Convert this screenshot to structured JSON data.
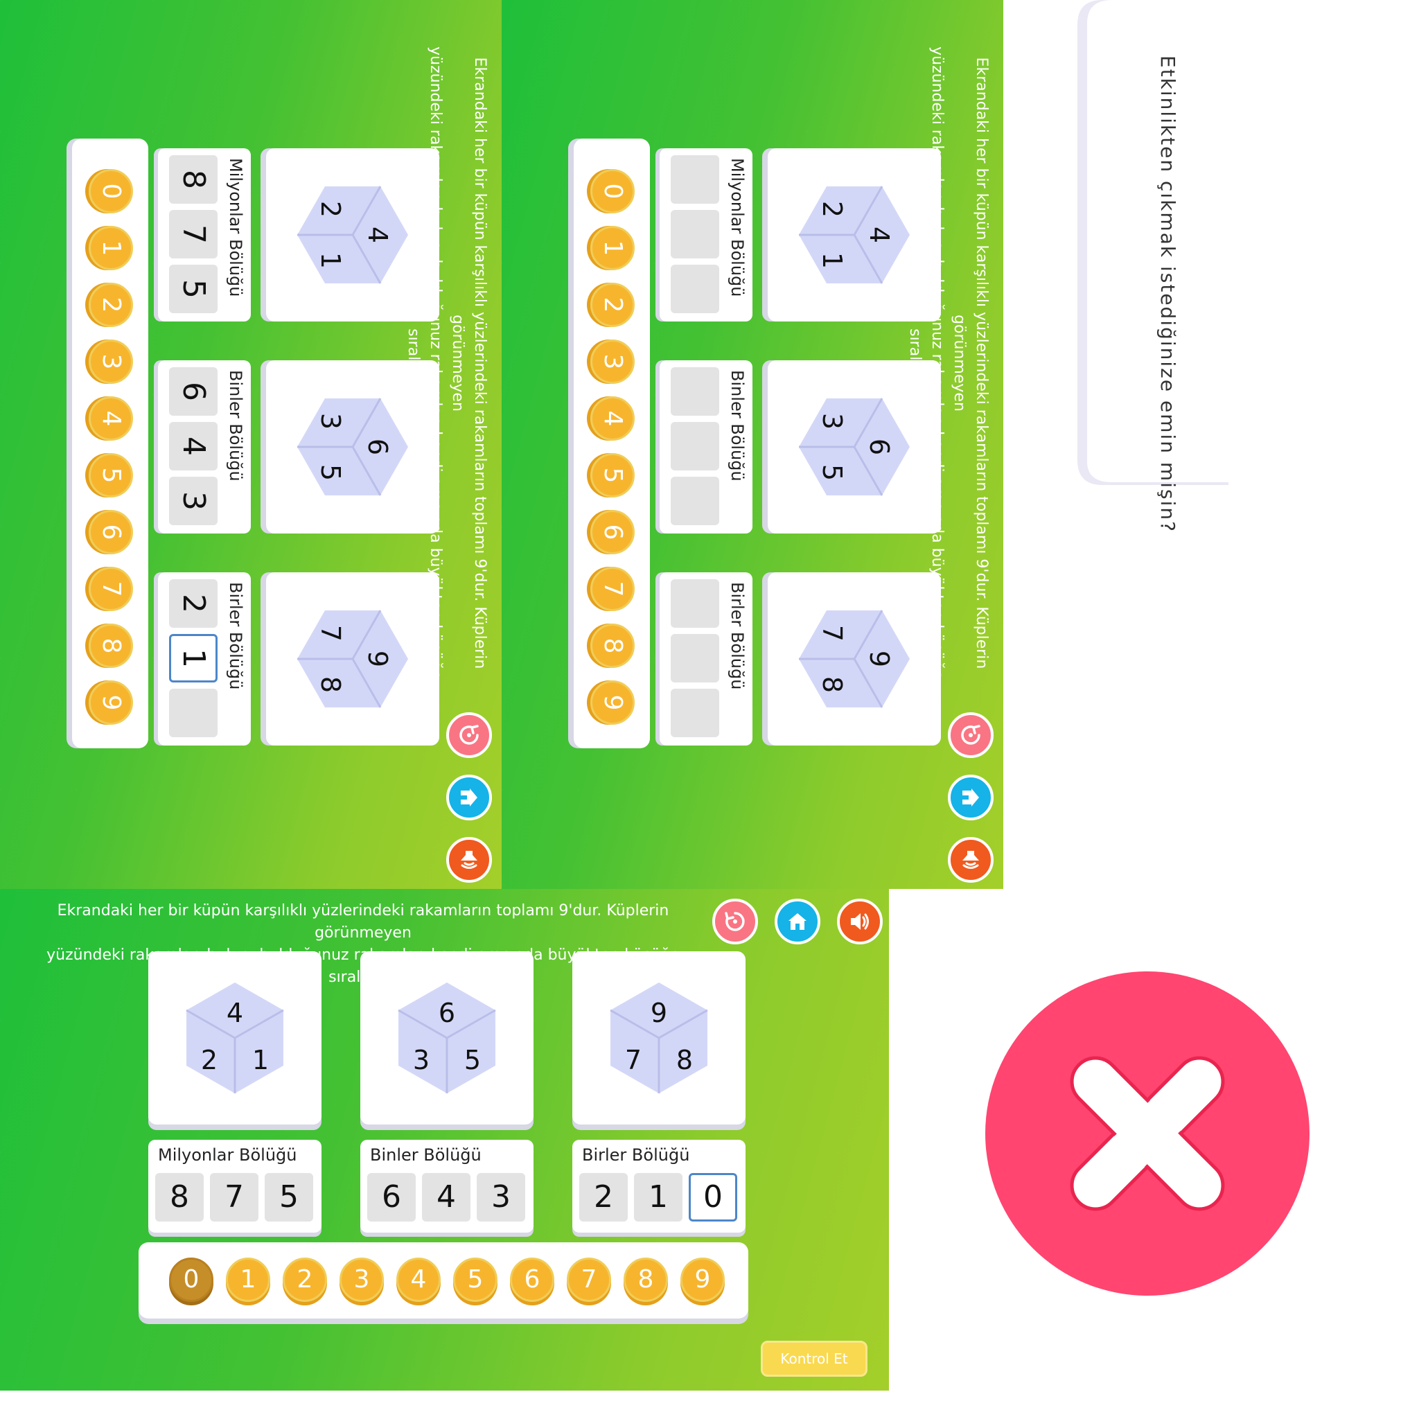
{
  "instruction": {
    "line1": "Ekrandaki her bir küpün karşılıklı yüzlerindeki rakamların  toplamı 9'dur. Küplerin görünmeyen",
    "line2": "yüzündeki  rakamları bulup, bulduğunuz rakamları kendi arasında büyükten küçüğe sıralayın."
  },
  "controls": {
    "reset": "reset-icon",
    "home": "home-icon",
    "sound": "sound-icon"
  },
  "cubes": [
    {
      "top": "4",
      "left": "2",
      "right": "1"
    },
    {
      "top": "6",
      "left": "3",
      "right": "5"
    },
    {
      "top": "9",
      "left": "7",
      "right": "8"
    }
  ],
  "panels": {
    "p1": {
      "boxes": [
        {
          "label": "Milyonlar Bölüğü",
          "slots": [
            "8",
            "7",
            "5"
          ]
        },
        {
          "label": "Binler Bölüğü",
          "slots": [
            "6",
            "4",
            "3"
          ]
        },
        {
          "label": "Birler Bölüğü",
          "slots": [
            "2",
            "1",
            ""
          ]
        }
      ],
      "active": "2.1"
    },
    "p2": {
      "boxes": [
        {
          "label": "Milyonlar Bölüğü",
          "slots": [
            "",
            "",
            ""
          ]
        },
        {
          "label": "Binler Bölüğü",
          "slots": [
            "",
            "",
            ""
          ]
        },
        {
          "label": "Birler Bölüğü",
          "slots": [
            "",
            "",
            ""
          ]
        }
      ]
    },
    "p3": {
      "boxes": [
        {
          "label": "Milyonlar Bölüğü",
          "slots": [
            "8",
            "7",
            "5"
          ]
        },
        {
          "label": "Binler Bölüğü",
          "slots": [
            "6",
            "4",
            "3"
          ]
        },
        {
          "label": "Birler Bölüğü",
          "slots": [
            "2",
            "1",
            "0"
          ]
        }
      ],
      "active": "2.2",
      "picked_coin": "0"
    }
  },
  "coins": [
    "0",
    "1",
    "2",
    "3",
    "4",
    "5",
    "6",
    "7",
    "8",
    "9"
  ],
  "check_button": "Kontrol Et",
  "dialog": {
    "message": "Etkinlikten  çıkmak  istediğinize  emin  mişin?"
  },
  "exit_icon": "close-x-icon",
  "colors": {
    "green": "#45bb33",
    "coin": "#f7b52e",
    "exit": "#ff4570",
    "check": "#f9d94f"
  }
}
